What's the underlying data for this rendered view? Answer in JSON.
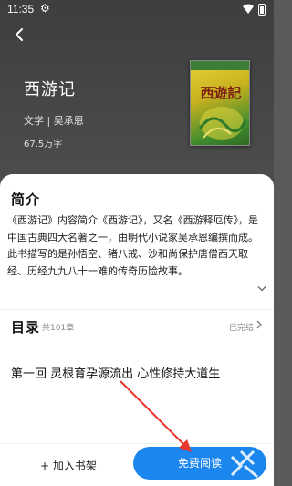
{
  "status_bar": {
    "time": "11:35"
  },
  "book": {
    "title": "西游记",
    "meta": "文学 | 吴承恩",
    "word_count": "67.5万字",
    "cover_title": "西遊記"
  },
  "intro": {
    "heading": "简介",
    "text": "《西游记》内容简介《西游记》，又名《西游释厄传》，是中国古典四大名著之一，由明代小说家吴承恩编撰而成。此书描写的是孙悟空、猪八戒、沙和尚保护唐僧西天取经、历经九九八十一难的传奇历险故事。"
  },
  "toc": {
    "heading": "目录",
    "count": "共101章",
    "status": "已完结",
    "first_chapter": "第一回 灵根育孕源流出 心性修持大道生"
  },
  "actions": {
    "add_shelf": "+ 加入书架",
    "read": "免费阅读"
  },
  "colors": {
    "header_bg": "#434343",
    "primary": "#1a86ee",
    "annotation_arrow": "#e8372c"
  }
}
